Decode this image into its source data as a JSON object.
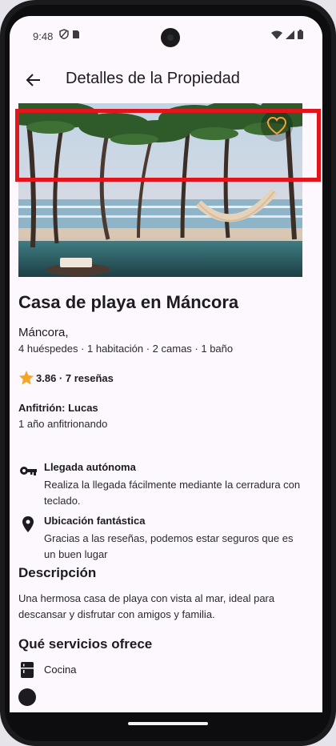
{
  "status_bar": {
    "time": "9:48"
  },
  "app_bar": {
    "title": "Detalles de la Propiedad"
  },
  "property": {
    "title": "Casa de playa en Máncora",
    "location": "Máncora,",
    "details": "4 huéspedes · 1 habitación · 2 camas · 1 baño",
    "rating": "3.86 · 7 reseñas",
    "host_name": "Anfitrión: Lucas",
    "host_years": "1 año anfitrionando"
  },
  "features": [
    {
      "icon": "key-icon",
      "title": "Llegada autónoma",
      "description": "Realiza la llegada fácilmente mediante la cerradura con teclado."
    },
    {
      "icon": "location-pin-icon",
      "title": "Ubicación fantástica",
      "description": "Gracias a las reseñas, podemos estar seguros que es un buen lugar"
    }
  ],
  "description": {
    "title": "Descripción",
    "text": "Una hermosa casa de playa con vista al mar, ideal para descansar y disfrutar con amigos y familia."
  },
  "services": {
    "title": "Qué servicios ofrece",
    "items": [
      {
        "icon": "kitchen-icon",
        "label": "Cocina"
      }
    ]
  },
  "colors": {
    "background": "#fdf7fe",
    "favorite_accent": "#f0a33a",
    "star": "#f5a623",
    "highlight": "#e3141b"
  }
}
